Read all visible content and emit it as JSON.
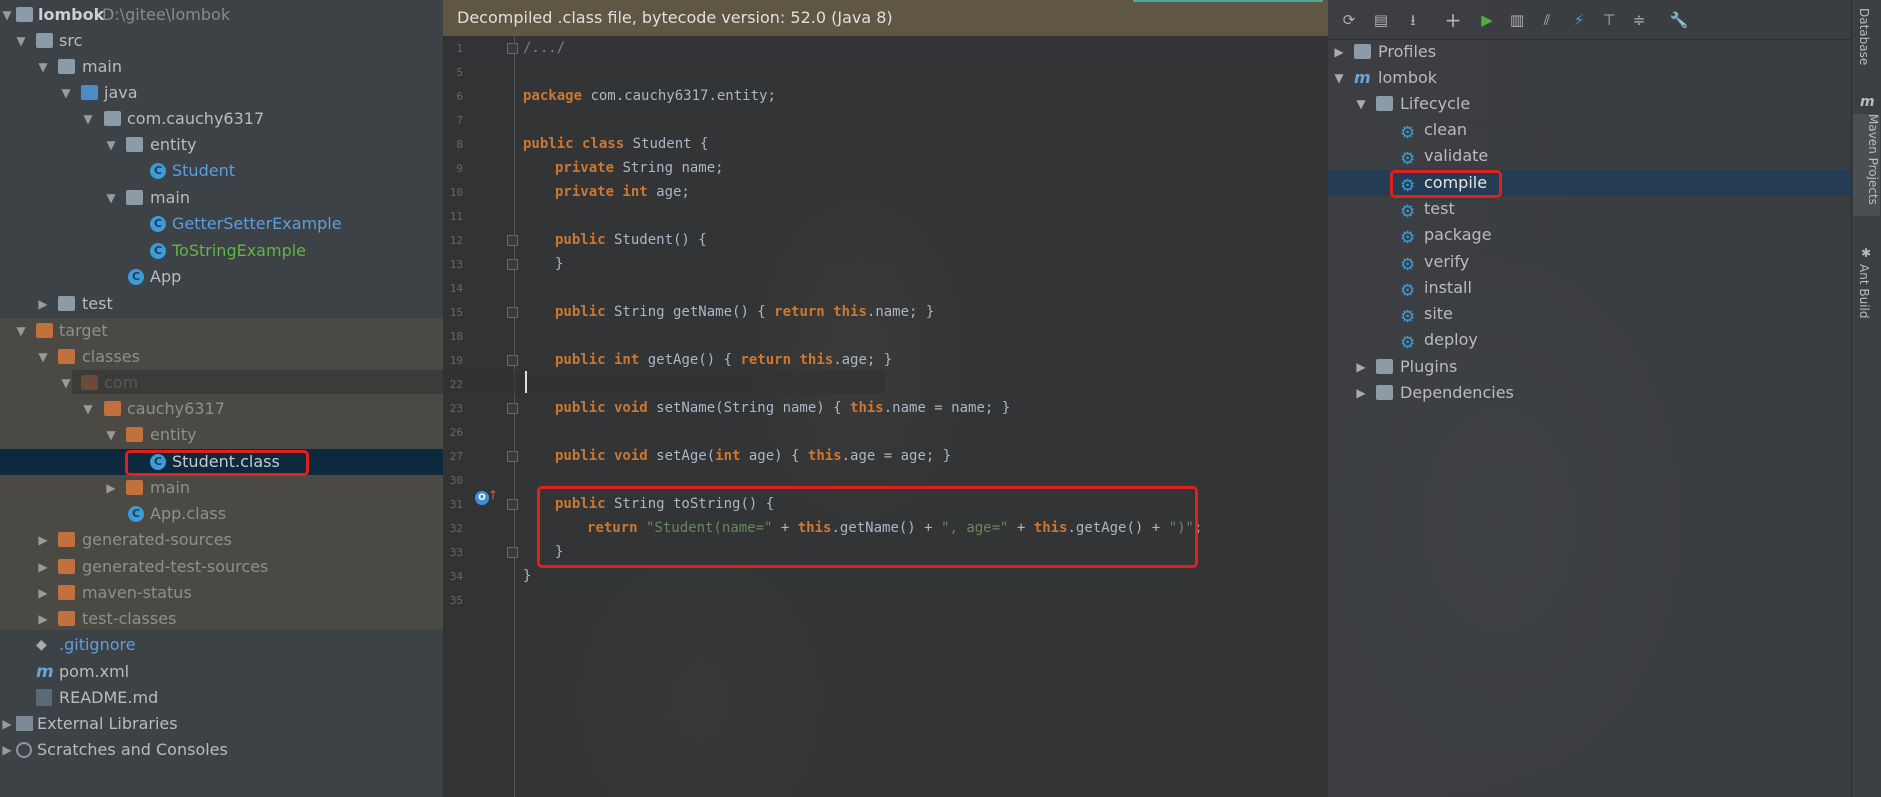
{
  "project_tree": {
    "root_name": "lombok",
    "root_path": "D:\\gitee\\lombok",
    "items": [
      {
        "label": "src"
      },
      {
        "label": "main"
      },
      {
        "label": "java"
      },
      {
        "label": "com.cauchy6317"
      },
      {
        "label": "entity"
      },
      {
        "label": "Student"
      },
      {
        "label": "main"
      },
      {
        "label": "GetterSetterExample"
      },
      {
        "label": "ToStringExample"
      },
      {
        "label": "App"
      },
      {
        "label": "test"
      },
      {
        "label": "target"
      },
      {
        "label": "classes"
      },
      {
        "label": "com"
      },
      {
        "label": "cauchy6317"
      },
      {
        "label": "entity"
      },
      {
        "label": "Student.class"
      },
      {
        "label": "main"
      },
      {
        "label": "App.class"
      },
      {
        "label": "generated-sources"
      },
      {
        "label": "generated-test-sources"
      },
      {
        "label": "maven-status"
      },
      {
        "label": "test-classes"
      },
      {
        "label": ".gitignore"
      },
      {
        "label": "pom.xml"
      },
      {
        "label": "README.md"
      },
      {
        "label": "External Libraries"
      },
      {
        "label": "Scratches and Consoles"
      }
    ]
  },
  "editor": {
    "banner": "Decompiled .class file, bytecode version: 52.0 (Java 8)",
    "line_numbers": [
      "1",
      "5",
      "6",
      "7",
      "8",
      "9",
      "10",
      "11",
      "12",
      "13",
      "14",
      "15",
      "18",
      "19",
      "22",
      "23",
      "26",
      "27",
      "30",
      "31",
      "32",
      "33",
      "34",
      "35"
    ],
    "code": {
      "l1": "/.../",
      "l6_kw": "package",
      "l6_rest": " com.cauchy6317.entity;",
      "l8_kw": "public class",
      "l8_rest": " Student {",
      "l9_kw": "private",
      "l9_rest": " String name;",
      "l10_kw": "private int",
      "l10_rest": " age;",
      "l12_kw": "public",
      "l12_rest": " Student() {",
      "l13": "}",
      "l15_kw": "public",
      "l15_a": " String getName() { ",
      "l15_ret": "return",
      "l15_this": " this",
      "l15_b": ".name; }",
      "l19_kw": "public int",
      "l19_a": " getAge() { ",
      "l19_ret": "return",
      "l19_this": " this",
      "l19_b": ".age; }",
      "l23_kw": "public void",
      "l23_a": " setName(String name) { ",
      "l23_this": "this",
      "l23_b": ".name = name; }",
      "l27_kw": "public void",
      "l27_a": " setAge(",
      "l27_int": "int",
      "l27_b": " age) { ",
      "l27_this": "this",
      "l27_c": ".age = age; }",
      "l31_kw": "public",
      "l31_rest": " String toString() {",
      "l32_ret": "return",
      "l32_s1": " \"Student(name=\"",
      "l32_p1": " + ",
      "l32_this1": "this",
      "l32_m1": ".getName() + ",
      "l32_s2": "\", age=\"",
      "l32_p2": " + ",
      "l32_this2": "this",
      "l32_m2": ".getAge() + ",
      "l32_s3": "\")\"",
      "l32_end": ";",
      "l33": "}",
      "l34": "}"
    }
  },
  "maven": {
    "profiles": "Profiles",
    "project": "lombok",
    "lifecycle": "Lifecycle",
    "phases": [
      "clean",
      "validate",
      "compile",
      "test",
      "package",
      "verify",
      "install",
      "site",
      "deploy"
    ],
    "plugins": "Plugins",
    "dependencies": "Dependencies"
  },
  "side_tabs": {
    "database": "Database",
    "maven_projects": "Maven Projects",
    "ant_build": "Ant Build"
  },
  "colors": {
    "highlight_box": "#e0201c",
    "selection": "#0d293e",
    "keyword": "#cc7832",
    "string": "#6a8759"
  }
}
